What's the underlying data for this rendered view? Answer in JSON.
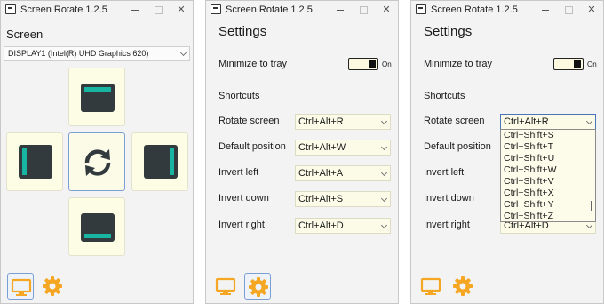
{
  "app_title": "Screen Rotate 1.2.5",
  "screen_label": "Screen",
  "display_select": "DISPLAY1 (Intel(R) UHD Graphics 620)",
  "settings": {
    "heading": "Settings",
    "minimize_label": "Minimize to tray",
    "toggle_state": "On",
    "shortcuts_heading": "Shortcuts",
    "rows": [
      {
        "label": "Rotate screen",
        "value": "Ctrl+Alt+R"
      },
      {
        "label": "Default position",
        "value": "Ctrl+Alt+W"
      },
      {
        "label": "Invert left",
        "value": "Ctrl+Alt+A"
      },
      {
        "label": "Invert down",
        "value": "Ctrl+Alt+S"
      },
      {
        "label": "Invert right",
        "value": "Ctrl+Alt+D"
      }
    ]
  },
  "dropdown_options": [
    "Ctrl+Shift+S",
    "Ctrl+Shift+T",
    "Ctrl+Shift+U",
    "Ctrl+Shift+W",
    "Ctrl+Shift+V",
    "Ctrl+Shift+X",
    "Ctrl+Shift+Y",
    "Ctrl+Shift+Z"
  ],
  "colors": {
    "accent": "#19b5a3",
    "tile_bg": "#fdfde6",
    "footer_icon": "#f5a623",
    "selection_border": "#7a9fd4"
  }
}
